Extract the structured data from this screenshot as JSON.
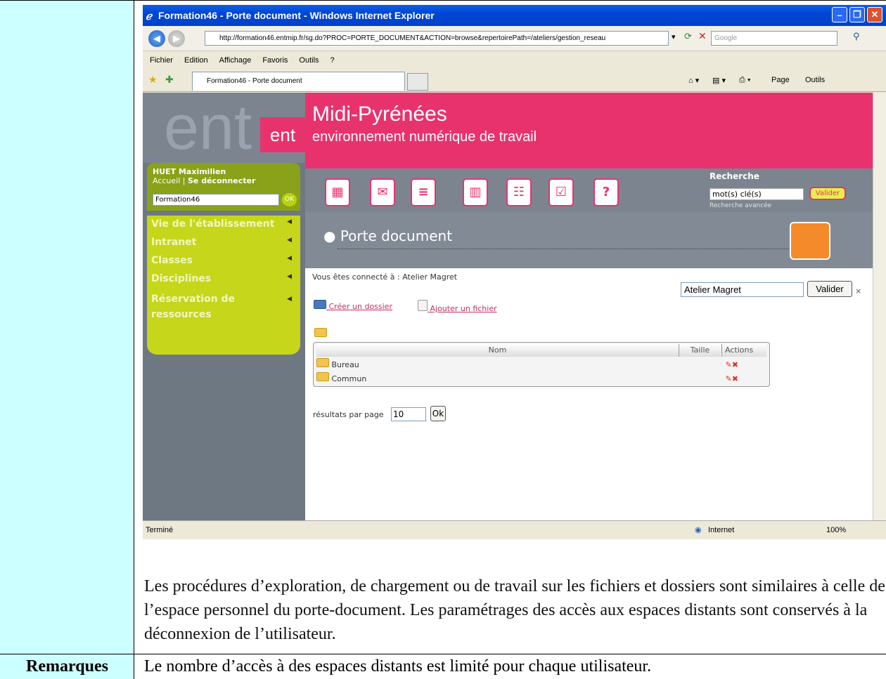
{
  "document": {
    "paragraph": "Les procédures d’exploration, de chargement ou de travail sur les fichiers et dossiers sont similaires à celle de l’espace personnel du porte-document. Les paramétrages des accès aux espaces distants sont conservés à la déconnexion de l’utilisateur.",
    "remarks_label": "Remarques",
    "remarks_text": "Le nombre d’accès à des espaces distants est limité pour chaque utilisateur."
  },
  "browser": {
    "title": "Formation46 - Porte document - Windows Internet Explorer",
    "url": "http://formation46.entmip.fr/sg.do?PROC=PORTE_DOCUMENT&ACTION=browse&repertoirePath=/ateliers/gestion_reseau",
    "search_placeholder": "Google",
    "menu": [
      "Fichier",
      "Edition",
      "Affichage",
      "Favoris",
      "Outils",
      "?"
    ],
    "tab_label": "Formation46 - Porte document",
    "page_label": "Page",
    "tools_label": "Outils",
    "status_left": "Terminé",
    "status_zone": "Internet",
    "zoom": "100%"
  },
  "site": {
    "logo_text": "ent",
    "logo_badge": "ent",
    "title": "Midi-Pyrénées",
    "subtitle": "environnement numérique de travail",
    "user_name": "HUET Maximilien",
    "accueil": "Accueil",
    "separator": "|",
    "deconnecter": "Se déconnecter",
    "select_value": "Formation46",
    "ok": "OK",
    "nav": [
      "Vie de l'établissement",
      "Intranet",
      "Classes",
      "Disciplines",
      "Réservation de ressources"
    ],
    "recherche_label": "Recherche",
    "recherche_value": "mot(s) clé(s)",
    "valider": "Valider",
    "recherche_avancee": "Recherche avancée",
    "section_title": "Porte document",
    "connected": "Vous êtes connecté à : Atelier Magret",
    "workspace_select": "Atelier Magret",
    "workspace_valider": "Valider",
    "close_x": "×",
    "create_folder": "Créer un dossier",
    "add_file": "Ajouter un fichier",
    "table_headers": [
      "Nom",
      "Taille",
      "Actions"
    ],
    "rows": [
      "Bureau",
      "Commun"
    ],
    "results_label": "résultats par page",
    "results_value": "10",
    "results_ok": "Ok"
  },
  "colors": {
    "pink": "#e8326e",
    "lime": "#c6d61a",
    "cyan_cell": "#ccffff"
  }
}
